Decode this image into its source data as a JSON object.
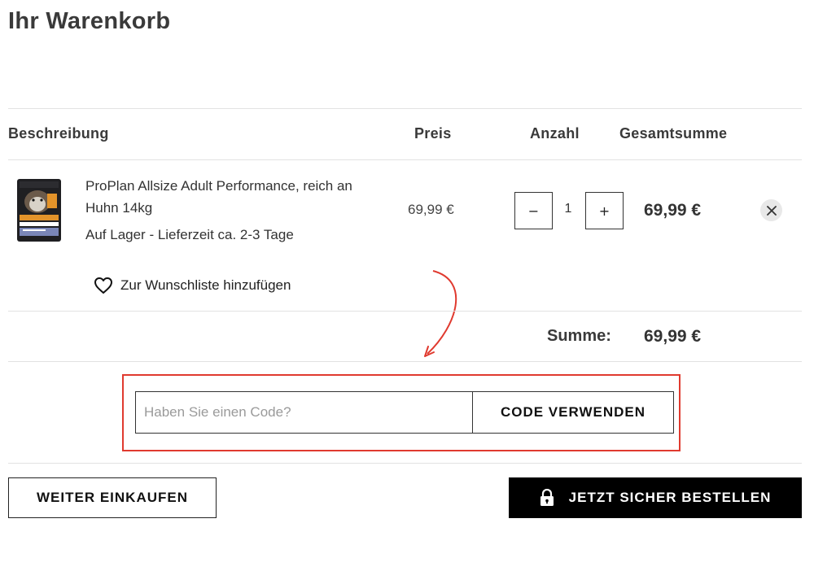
{
  "page": {
    "title": "Ihr Warenkorb"
  },
  "table": {
    "headers": {
      "description": "Beschreibung",
      "price": "Preis",
      "quantity": "Anzahl",
      "total": "Gesamtsumme"
    }
  },
  "item": {
    "name": "ProPlan Allsize Adult Performance, reich an Huhn 14kg",
    "availability": "Auf Lager - Lieferzeit ca. 2-3 Tage",
    "unit_price": "69,99 €",
    "quantity": "1",
    "decrement_label": "−",
    "increment_label": "+",
    "line_total": "69,99 €",
    "thumbnail_icon": "product-bag-image",
    "remove_icon": "close-icon",
    "wishlist_label": "Zur Wunschliste hinzufügen",
    "wishlist_icon": "heart-icon"
  },
  "summary": {
    "label": "Summe:",
    "value": "69,99 €"
  },
  "coupon": {
    "placeholder": "Haben Sie einen Code?",
    "value": "",
    "button_label": "CODE VERWENDEN",
    "highlight_color": "#e03a2f"
  },
  "actions": {
    "continue_label": "WEITER EINKAUFEN",
    "checkout_label": "JETZT SICHER BESTELLEN",
    "checkout_icon": "lock-icon"
  }
}
